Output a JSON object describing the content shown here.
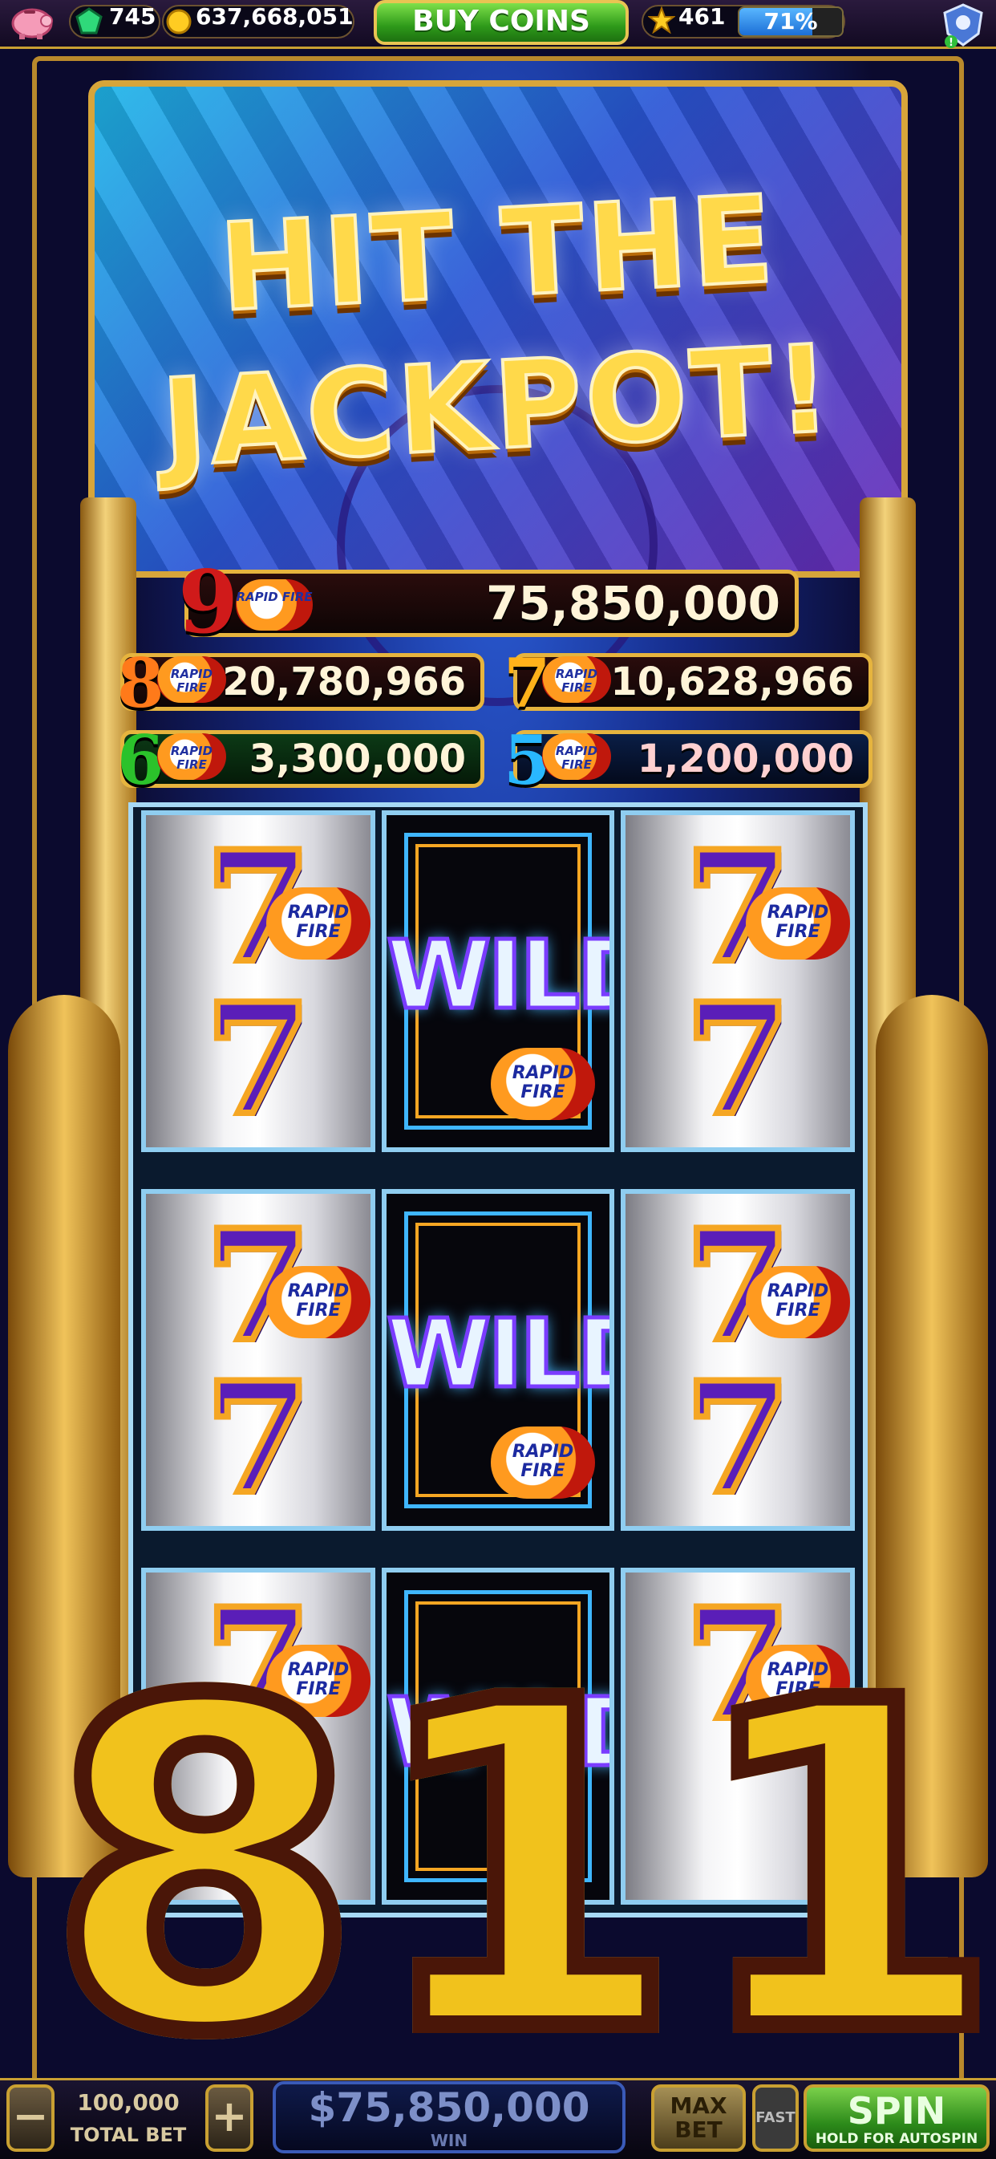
{
  "top_bar": {
    "gems": "745",
    "coins": "637,668,051",
    "buy_coins_label": "BUY COINS",
    "level": "461",
    "xp_percent_label": "71%",
    "xp_fraction": 0.71
  },
  "headline": {
    "line1": "HIT THE",
    "line2": "JACKPOT!"
  },
  "jackpots": [
    {
      "num": "9",
      "badge": "RAPID FIRE",
      "value": "75,850,000",
      "num_color": "#d01a1a"
    },
    {
      "num": "8",
      "badge": "RAPID FIRE",
      "value": "20,780,966",
      "num_color": "#ff7a1a"
    },
    {
      "num": "7",
      "badge": "RAPID FIRE",
      "value": "10,628,966",
      "num_color": "#ffb21a"
    },
    {
      "num": "6",
      "badge": "RAPID FIRE",
      "value": "3,300,000",
      "num_color": "#2bc22b"
    },
    {
      "num": "5",
      "badge": "RAPID FIRE",
      "value": "1,200,000",
      "num_color": "#29b8ff"
    }
  ],
  "reels": {
    "seven_symbol": "7",
    "wild_label": "WILD",
    "rf_label": "RAPID FIRE"
  },
  "overlay_number": "811",
  "bottom_bar": {
    "minus": "−",
    "plus": "+",
    "total_bet_value": "100,000",
    "total_bet_label": "TOTAL BET",
    "win_value": "$75,850,000",
    "win_label": "WIN",
    "max_bet_label": "MAX BET",
    "fast_label": "FAST",
    "spin_label": "SPIN",
    "spin_sub": "HOLD FOR AUTOSPIN"
  },
  "colors": {
    "gold": "#c9a032",
    "accent_green": "#2e9a1a",
    "xp_blue": "#1c6fd6"
  }
}
